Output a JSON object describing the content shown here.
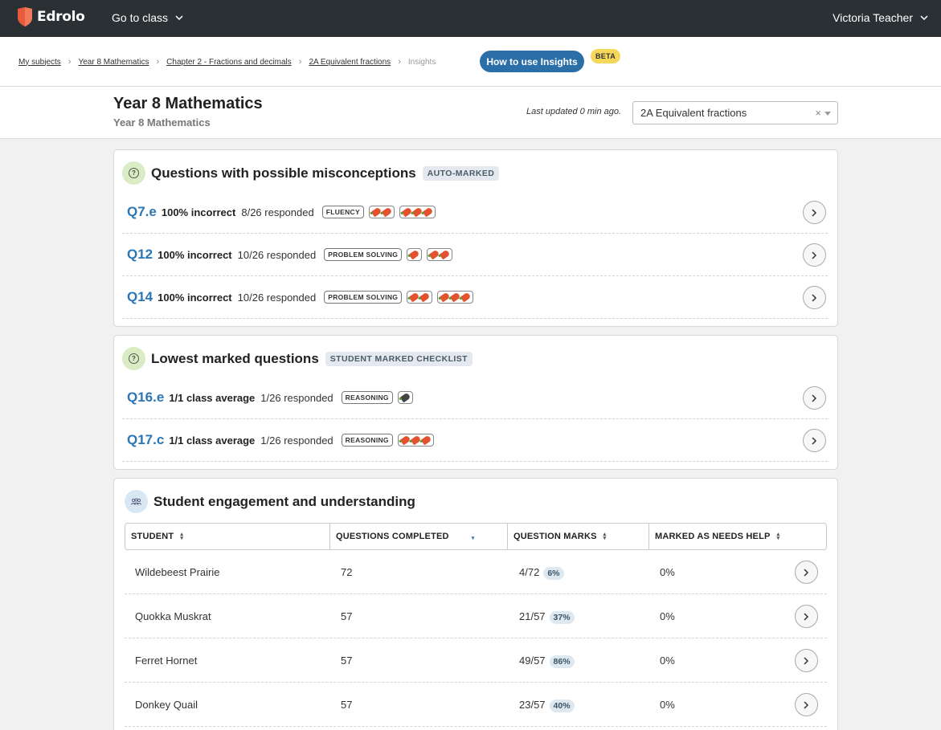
{
  "nav": {
    "brand": "Edrolo",
    "go_to_class": "Go to class",
    "user_name": "Victoria Teacher"
  },
  "breadcrumbs": {
    "items": [
      "My subjects",
      "Year 8 Mathematics",
      "Chapter 2 - Fractions and decimals",
      "2A Equivalent fractions"
    ],
    "current": "Insights",
    "how_to_button": "How to use Insights",
    "beta_badge": "BETA"
  },
  "header": {
    "title": "Year 8 Mathematics",
    "subtitle": "Year 8 Mathematics",
    "last_updated": "Last updated 0 min ago.",
    "section_select": "2A Equivalent fractions",
    "clear_glyph": "×"
  },
  "misconceptions": {
    "title": "Questions with possible misconceptions",
    "tag": "AUTO-MARKED",
    "rows": [
      {
        "id": "Q7.e",
        "stat": "100% incorrect",
        "responded": "8/26 responded",
        "skill": "FLUENCY",
        "difficulty_group1": 2,
        "difficulty_group2": 3
      },
      {
        "id": "Q12",
        "stat": "100% incorrect",
        "responded": "10/26 responded",
        "skill": "PROBLEM SOLVING",
        "difficulty_group1": 1,
        "difficulty_group2": 2
      },
      {
        "id": "Q14",
        "stat": "100% incorrect",
        "responded": "10/26 responded",
        "skill": "PROBLEM SOLVING",
        "difficulty_group1": 2,
        "difficulty_group2": 3
      }
    ]
  },
  "lowest": {
    "title": "Lowest marked questions",
    "tag": "STUDENT MARKED CHECKLIST",
    "rows": [
      {
        "id": "Q16.e",
        "stat": "1/1 class average",
        "responded": "1/26 responded",
        "skill": "REASONING",
        "difficulty": 1
      },
      {
        "id": "Q17.c",
        "stat": "1/1 class average",
        "responded": "1/26 responded",
        "skill": "REASONING",
        "difficulty": 3
      }
    ]
  },
  "engagement": {
    "title": "Student engagement and understanding",
    "columns": [
      "STUDENT",
      "QUESTIONS COMPLETED",
      "QUESTION MARKS",
      "MARKED AS NEEDS HELP"
    ],
    "rows": [
      {
        "student": "Wildebeest Prairie",
        "completed": "72",
        "marks": "4/72",
        "pct": "6%",
        "needs_help": "0%"
      },
      {
        "student": "Quokka Muskrat",
        "completed": "57",
        "marks": "21/57",
        "pct": "37%",
        "needs_help": "0%"
      },
      {
        "student": "Ferret Hornet",
        "completed": "57",
        "marks": "49/57",
        "pct": "86%",
        "needs_help": "0%"
      },
      {
        "student": "Donkey Quail",
        "completed": "57",
        "marks": "23/57",
        "pct": "40%",
        "needs_help": "0%"
      }
    ]
  },
  "colors": {
    "nav_bg": "#2a3034",
    "accent_blue": "#2b6fa8",
    "question_link": "#2b76b5",
    "beta_yellow": "#f5d75a",
    "chili_red": "#e4512f"
  },
  "icons": {
    "logo": "shield-logo-icon",
    "question": "question-circle-icon",
    "engagement": "students-icon",
    "chevron_down": "chevron-down-icon",
    "chevron_right": "chevron-right-icon",
    "sort": "sort-icon",
    "difficulty": "chili-icon"
  }
}
